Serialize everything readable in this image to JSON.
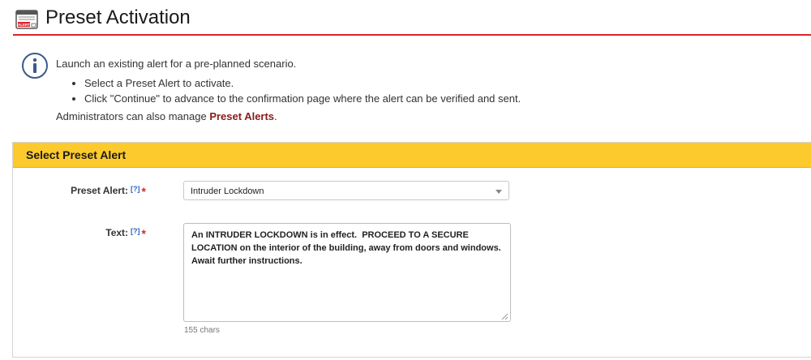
{
  "header": {
    "title": "Preset Activation",
    "icon": "alert-window-icon",
    "icon_badge": "ALERT",
    "accent_color": "#d9262b"
  },
  "info": {
    "icon": "info-icon",
    "intro": "Launch an existing alert for a pre-planned scenario.",
    "bullets": [
      "Select a Preset Alert to activate.",
      "Click \"Continue\" to advance to the confirmation page where the alert can be verified and sent."
    ],
    "admin_prefix": "Administrators can also manage ",
    "admin_link": "Preset Alerts",
    "admin_suffix": "."
  },
  "panel": {
    "title": "Select Preset Alert",
    "header_color": "#fdca2e",
    "preset_alert": {
      "label": "Preset Alert:",
      "help": "[?]",
      "required": "*",
      "value": "Intruder Lockdown"
    },
    "text_field": {
      "label": "Text:",
      "help": "[?]",
      "required": "*",
      "value": "An INTRUDER LOCKDOWN is in effect.  PROCEED TO A SECURE LOCATION on the interior of the building, away from doors and windows. Await further instructions.",
      "char_count": "155 chars"
    }
  }
}
